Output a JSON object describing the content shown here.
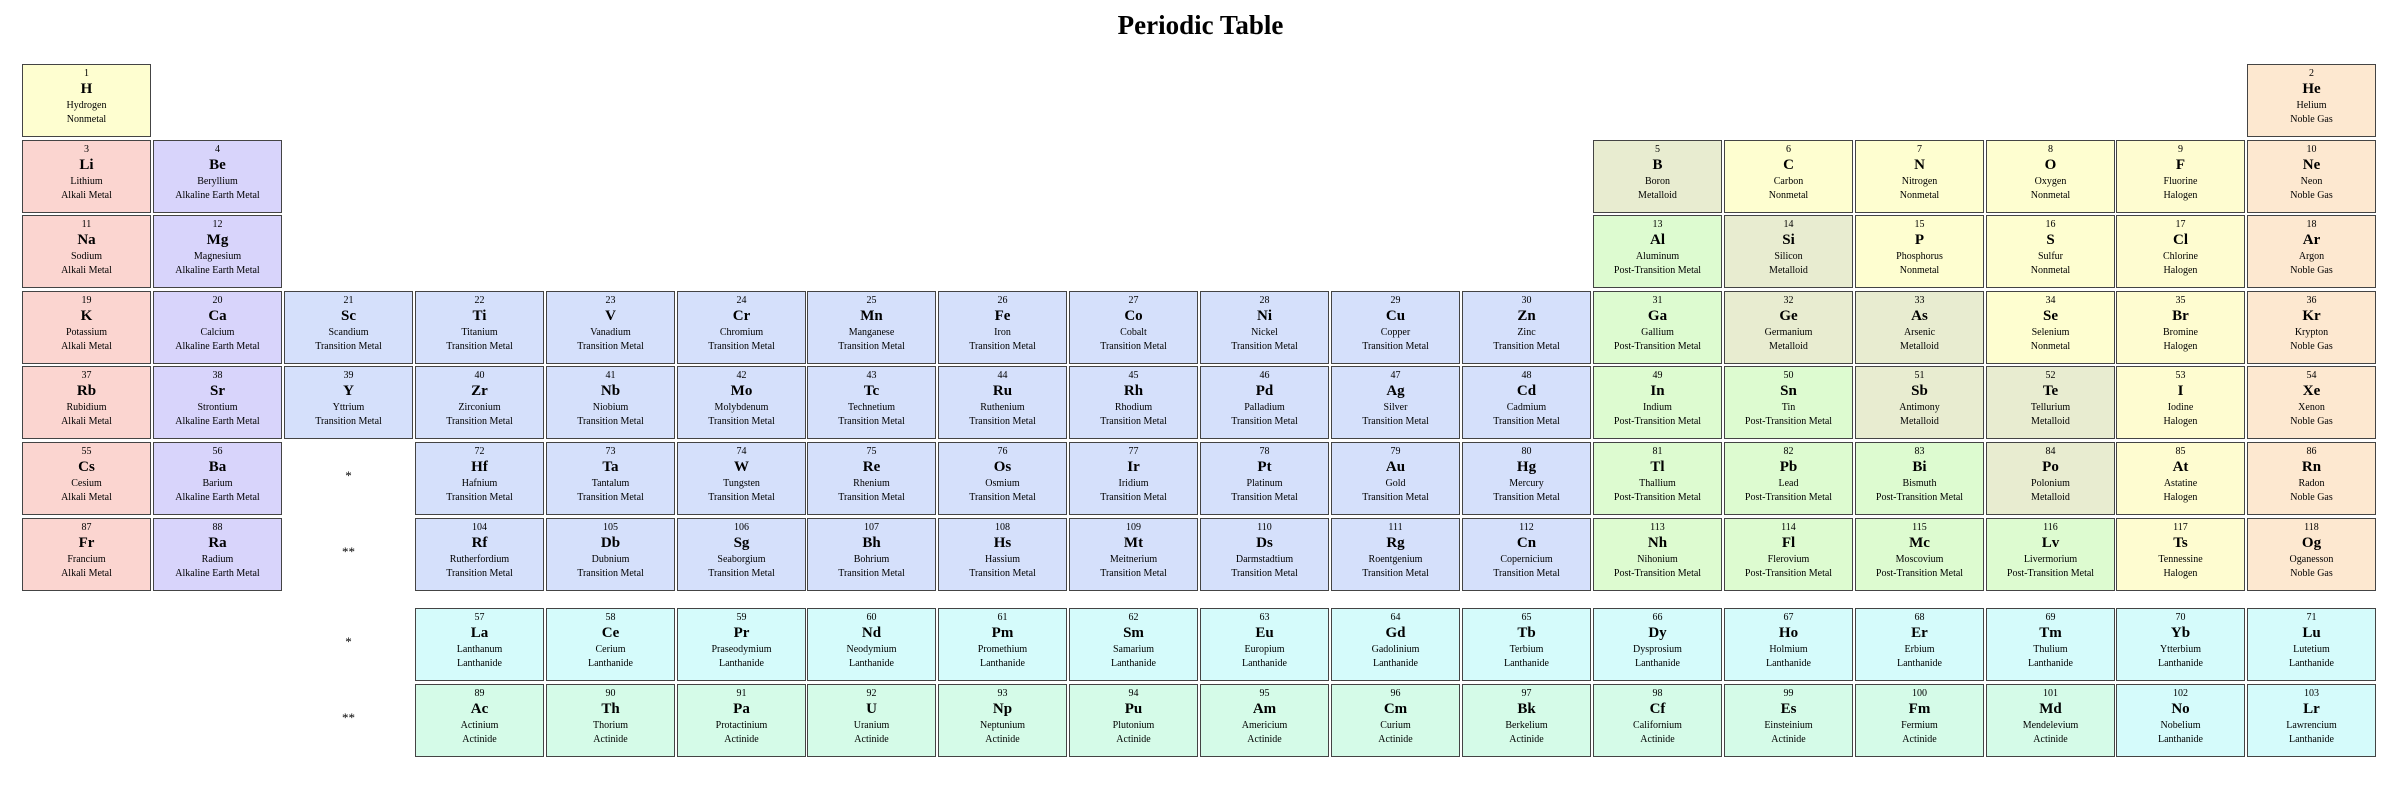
{
  "title": "Periodic Table",
  "category_colors": {
    "Nonmetal": "#fefed0",
    "Noble Gas": "#fde8d0",
    "Alkali Metal": "#fbd5d0",
    "Alkaline Earth Metal": "#d8d4fb",
    "Transition Metal": "#d5e0fb",
    "Metalloid": "#e8ecd0",
    "Post-Transition Metal": "#ddfbd0",
    "Halogen": "#fefcd0",
    "Lanthanide": "#d5fbfb",
    "Actinide": "#d5fbe8"
  },
  "markers": [
    {
      "text": "*",
      "row": 5,
      "col": 2
    },
    {
      "text": "**",
      "row": 6,
      "col": 2
    },
    {
      "text": "*",
      "row": 8,
      "col": 2
    },
    {
      "text": "**",
      "row": 9,
      "col": 2
    }
  ],
  "elements": [
    {
      "n": "1",
      "s": "H",
      "name": "Hydrogen",
      "cat": "Nonmetal",
      "row": 0,
      "col": 0
    },
    {
      "n": "2",
      "s": "He",
      "name": "Helium",
      "cat": "Noble Gas",
      "row": 0,
      "col": 17
    },
    {
      "n": "3",
      "s": "Li",
      "name": "Lithium",
      "cat": "Alkali Metal",
      "row": 1,
      "col": 0
    },
    {
      "n": "4",
      "s": "Be",
      "name": "Beryllium",
      "cat": "Alkaline Earth Metal",
      "row": 1,
      "col": 1
    },
    {
      "n": "5",
      "s": "B",
      "name": "Boron",
      "cat": "Metalloid",
      "row": 1,
      "col": 12
    },
    {
      "n": "6",
      "s": "C",
      "name": "Carbon",
      "cat": "Nonmetal",
      "row": 1,
      "col": 13
    },
    {
      "n": "7",
      "s": "N",
      "name": "Nitrogen",
      "cat": "Nonmetal",
      "row": 1,
      "col": 14
    },
    {
      "n": "8",
      "s": "O",
      "name": "Oxygen",
      "cat": "Nonmetal",
      "row": 1,
      "col": 15
    },
    {
      "n": "9",
      "s": "F",
      "name": "Fluorine",
      "cat": "Halogen",
      "row": 1,
      "col": 16
    },
    {
      "n": "10",
      "s": "Ne",
      "name": "Neon",
      "cat": "Noble Gas",
      "row": 1,
      "col": 17
    },
    {
      "n": "11",
      "s": "Na",
      "name": "Sodium",
      "cat": "Alkali Metal",
      "row": 2,
      "col": 0
    },
    {
      "n": "12",
      "s": "Mg",
      "name": "Magnesium",
      "cat": "Alkaline Earth Metal",
      "row": 2,
      "col": 1
    },
    {
      "n": "13",
      "s": "Al",
      "name": "Aluminum",
      "cat": "Post-Transition Metal",
      "row": 2,
      "col": 12
    },
    {
      "n": "14",
      "s": "Si",
      "name": "Silicon",
      "cat": "Metalloid",
      "row": 2,
      "col": 13
    },
    {
      "n": "15",
      "s": "P",
      "name": "Phosphorus",
      "cat": "Nonmetal",
      "row": 2,
      "col": 14
    },
    {
      "n": "16",
      "s": "S",
      "name": "Sulfur",
      "cat": "Nonmetal",
      "row": 2,
      "col": 15
    },
    {
      "n": "17",
      "s": "Cl",
      "name": "Chlorine",
      "cat": "Halogen",
      "row": 2,
      "col": 16
    },
    {
      "n": "18",
      "s": "Ar",
      "name": "Argon",
      "cat": "Noble Gas",
      "row": 2,
      "col": 17
    },
    {
      "n": "19",
      "s": "K",
      "name": "Potassium",
      "cat": "Alkali Metal",
      "row": 3,
      "col": 0
    },
    {
      "n": "20",
      "s": "Ca",
      "name": "Calcium",
      "cat": "Alkaline Earth Metal",
      "row": 3,
      "col": 1
    },
    {
      "n": "21",
      "s": "Sc",
      "name": "Scandium",
      "cat": "Transition Metal",
      "row": 3,
      "col": 2
    },
    {
      "n": "22",
      "s": "Ti",
      "name": "Titanium",
      "cat": "Transition Metal",
      "row": 3,
      "col": 3
    },
    {
      "n": "23",
      "s": "V",
      "name": "Vanadium",
      "cat": "Transition Metal",
      "row": 3,
      "col": 4
    },
    {
      "n": "24",
      "s": "Cr",
      "name": "Chromium",
      "cat": "Transition Metal",
      "row": 3,
      "col": 5
    },
    {
      "n": "25",
      "s": "Mn",
      "name": "Manganese",
      "cat": "Transition Metal",
      "row": 3,
      "col": 6
    },
    {
      "n": "26",
      "s": "Fe",
      "name": "Iron",
      "cat": "Transition Metal",
      "row": 3,
      "col": 7
    },
    {
      "n": "27",
      "s": "Co",
      "name": "Cobalt",
      "cat": "Transition Metal",
      "row": 3,
      "col": 8
    },
    {
      "n": "28",
      "s": "Ni",
      "name": "Nickel",
      "cat": "Transition Metal",
      "row": 3,
      "col": 9
    },
    {
      "n": "29",
      "s": "Cu",
      "name": "Copper",
      "cat": "Transition Metal",
      "row": 3,
      "col": 10
    },
    {
      "n": "30",
      "s": "Zn",
      "name": "Zinc",
      "cat": "Transition Metal",
      "row": 3,
      "col": 11
    },
    {
      "n": "31",
      "s": "Ga",
      "name": "Gallium",
      "cat": "Post-Transition Metal",
      "row": 3,
      "col": 12
    },
    {
      "n": "32",
      "s": "Ge",
      "name": "Germanium",
      "cat": "Metalloid",
      "row": 3,
      "col": 13
    },
    {
      "n": "33",
      "s": "As",
      "name": "Arsenic",
      "cat": "Metalloid",
      "row": 3,
      "col": 14
    },
    {
      "n": "34",
      "s": "Se",
      "name": "Selenium",
      "cat": "Nonmetal",
      "row": 3,
      "col": 15
    },
    {
      "n": "35",
      "s": "Br",
      "name": "Bromine",
      "cat": "Halogen",
      "row": 3,
      "col": 16
    },
    {
      "n": "36",
      "s": "Kr",
      "name": "Krypton",
      "cat": "Noble Gas",
      "row": 3,
      "col": 17
    },
    {
      "n": "37",
      "s": "Rb",
      "name": "Rubidium",
      "cat": "Alkali Metal",
      "row": 4,
      "col": 0
    },
    {
      "n": "38",
      "s": "Sr",
      "name": "Strontium",
      "cat": "Alkaline Earth Metal",
      "row": 4,
      "col": 1
    },
    {
      "n": "39",
      "s": "Y",
      "name": "Yttrium",
      "cat": "Transition Metal",
      "row": 4,
      "col": 2
    },
    {
      "n": "40",
      "s": "Zr",
      "name": "Zirconium",
      "cat": "Transition Metal",
      "row": 4,
      "col": 3
    },
    {
      "n": "41",
      "s": "Nb",
      "name": "Niobium",
      "cat": "Transition Metal",
      "row": 4,
      "col": 4
    },
    {
      "n": "42",
      "s": "Mo",
      "name": "Molybdenum",
      "cat": "Transition Metal",
      "row": 4,
      "col": 5
    },
    {
      "n": "43",
      "s": "Tc",
      "name": "Technetium",
      "cat": "Transition Metal",
      "row": 4,
      "col": 6
    },
    {
      "n": "44",
      "s": "Ru",
      "name": "Ruthenium",
      "cat": "Transition Metal",
      "row": 4,
      "col": 7
    },
    {
      "n": "45",
      "s": "Rh",
      "name": "Rhodium",
      "cat": "Transition Metal",
      "row": 4,
      "col": 8
    },
    {
      "n": "46",
      "s": "Pd",
      "name": "Palladium",
      "cat": "Transition Metal",
      "row": 4,
      "col": 9
    },
    {
      "n": "47",
      "s": "Ag",
      "name": "Silver",
      "cat": "Transition Metal",
      "row": 4,
      "col": 10
    },
    {
      "n": "48",
      "s": "Cd",
      "name": "Cadmium",
      "cat": "Transition Metal",
      "row": 4,
      "col": 11
    },
    {
      "n": "49",
      "s": "In",
      "name": "Indium",
      "cat": "Post-Transition Metal",
      "row": 4,
      "col": 12
    },
    {
      "n": "50",
      "s": "Sn",
      "name": "Tin",
      "cat": "Post-Transition Metal",
      "row": 4,
      "col": 13
    },
    {
      "n": "51",
      "s": "Sb",
      "name": "Antimony",
      "cat": "Metalloid",
      "row": 4,
      "col": 14
    },
    {
      "n": "52",
      "s": "Te",
      "name": "Tellurium",
      "cat": "Metalloid",
      "row": 4,
      "col": 15
    },
    {
      "n": "53",
      "s": "I",
      "name": "Iodine",
      "cat": "Halogen",
      "row": 4,
      "col": 16
    },
    {
      "n": "54",
      "s": "Xe",
      "name": "Xenon",
      "cat": "Noble Gas",
      "row": 4,
      "col": 17
    },
    {
      "n": "55",
      "s": "Cs",
      "name": "Cesium",
      "cat": "Alkali Metal",
      "row": 5,
      "col": 0
    },
    {
      "n": "56",
      "s": "Ba",
      "name": "Barium",
      "cat": "Alkaline Earth Metal",
      "row": 5,
      "col": 1
    },
    {
      "n": "72",
      "s": "Hf",
      "name": "Hafnium",
      "cat": "Transition Metal",
      "row": 5,
      "col": 3
    },
    {
      "n": "73",
      "s": "Ta",
      "name": "Tantalum",
      "cat": "Transition Metal",
      "row": 5,
      "col": 4
    },
    {
      "n": "74",
      "s": "W",
      "name": "Tungsten",
      "cat": "Transition Metal",
      "row": 5,
      "col": 5
    },
    {
      "n": "75",
      "s": "Re",
      "name": "Rhenium",
      "cat": "Transition Metal",
      "row": 5,
      "col": 6
    },
    {
      "n": "76",
      "s": "Os",
      "name": "Osmium",
      "cat": "Transition Metal",
      "row": 5,
      "col": 7
    },
    {
      "n": "77",
      "s": "Ir",
      "name": "Iridium",
      "cat": "Transition Metal",
      "row": 5,
      "col": 8
    },
    {
      "n": "78",
      "s": "Pt",
      "name": "Platinum",
      "cat": "Transition Metal",
      "row": 5,
      "col": 9
    },
    {
      "n": "79",
      "s": "Au",
      "name": "Gold",
      "cat": "Transition Metal",
      "row": 5,
      "col": 10
    },
    {
      "n": "80",
      "s": "Hg",
      "name": "Mercury",
      "cat": "Transition Metal",
      "row": 5,
      "col": 11
    },
    {
      "n": "81",
      "s": "Tl",
      "name": "Thallium",
      "cat": "Post-Transition Metal",
      "row": 5,
      "col": 12
    },
    {
      "n": "82",
      "s": "Pb",
      "name": "Lead",
      "cat": "Post-Transition Metal",
      "row": 5,
      "col": 13
    },
    {
      "n": "83",
      "s": "Bi",
      "name": "Bismuth",
      "cat": "Post-Transition Metal",
      "row": 5,
      "col": 14
    },
    {
      "n": "84",
      "s": "Po",
      "name": "Polonium",
      "cat": "Metalloid",
      "row": 5,
      "col": 15
    },
    {
      "n": "85",
      "s": "At",
      "name": "Astatine",
      "cat": "Halogen",
      "row": 5,
      "col": 16
    },
    {
      "n": "86",
      "s": "Rn",
      "name": "Radon",
      "cat": "Noble Gas",
      "row": 5,
      "col": 17
    },
    {
      "n": "87",
      "s": "Fr",
      "name": "Francium",
      "cat": "Alkali Metal",
      "row": 6,
      "col": 0
    },
    {
      "n": "88",
      "s": "Ra",
      "name": "Radium",
      "cat": "Alkaline Earth Metal",
      "row": 6,
      "col": 1
    },
    {
      "n": "104",
      "s": "Rf",
      "name": "Rutherfordium",
      "cat": "Transition Metal",
      "row": 6,
      "col": 3
    },
    {
      "n": "105",
      "s": "Db",
      "name": "Dubnium",
      "cat": "Transition Metal",
      "row": 6,
      "col": 4
    },
    {
      "n": "106",
      "s": "Sg",
      "name": "Seaborgium",
      "cat": "Transition Metal",
      "row": 6,
      "col": 5
    },
    {
      "n": "107",
      "s": "Bh",
      "name": "Bohrium",
      "cat": "Transition Metal",
      "row": 6,
      "col": 6
    },
    {
      "n": "108",
      "s": "Hs",
      "name": "Hassium",
      "cat": "Transition Metal",
      "row": 6,
      "col": 7
    },
    {
      "n": "109",
      "s": "Mt",
      "name": "Meitnerium",
      "cat": "Transition Metal",
      "row": 6,
      "col": 8
    },
    {
      "n": "110",
      "s": "Ds",
      "name": "Darmstadtium",
      "cat": "Transition Metal",
      "row": 6,
      "col": 9
    },
    {
      "n": "111",
      "s": "Rg",
      "name": "Roentgenium",
      "cat": "Transition Metal",
      "row": 6,
      "col": 10
    },
    {
      "n": "112",
      "s": "Cn",
      "name": "Copernicium",
      "cat": "Transition Metal",
      "row": 6,
      "col": 11
    },
    {
      "n": "113",
      "s": "Nh",
      "name": "Nihonium",
      "cat": "Post-Transition Metal",
      "row": 6,
      "col": 12
    },
    {
      "n": "114",
      "s": "Fl",
      "name": "Flerovium",
      "cat": "Post-Transition Metal",
      "row": 6,
      "col": 13
    },
    {
      "n": "115",
      "s": "Mc",
      "name": "Moscovium",
      "cat": "Post-Transition Metal",
      "row": 6,
      "col": 14
    },
    {
      "n": "116",
      "s": "Lv",
      "name": "Livermorium",
      "cat": "Post-Transition Metal",
      "row": 6,
      "col": 15
    },
    {
      "n": "117",
      "s": "Ts",
      "name": "Tennessine",
      "cat": "Halogen",
      "row": 6,
      "col": 16
    },
    {
      "n": "118",
      "s": "Og",
      "name": "Oganesson",
      "cat": "Noble Gas",
      "row": 6,
      "col": 17
    },
    {
      "n": "57",
      "s": "La",
      "name": "Lanthanum",
      "cat": "Lanthanide",
      "row": 8,
      "col": 3
    },
    {
      "n": "58",
      "s": "Ce",
      "name": "Cerium",
      "cat": "Lanthanide",
      "row": 8,
      "col": 4
    },
    {
      "n": "59",
      "s": "Pr",
      "name": "Praseodymium",
      "cat": "Lanthanide",
      "row": 8,
      "col": 5
    },
    {
      "n": "60",
      "s": "Nd",
      "name": "Neodymium",
      "cat": "Lanthanide",
      "row": 8,
      "col": 6
    },
    {
      "n": "61",
      "s": "Pm",
      "name": "Promethium",
      "cat": "Lanthanide",
      "row": 8,
      "col": 7
    },
    {
      "n": "62",
      "s": "Sm",
      "name": "Samarium",
      "cat": "Lanthanide",
      "row": 8,
      "col": 8
    },
    {
      "n": "63",
      "s": "Eu",
      "name": "Europium",
      "cat": "Lanthanide",
      "row": 8,
      "col": 9
    },
    {
      "n": "64",
      "s": "Gd",
      "name": "Gadolinium",
      "cat": "Lanthanide",
      "row": 8,
      "col": 10
    },
    {
      "n": "65",
      "s": "Tb",
      "name": "Terbium",
      "cat": "Lanthanide",
      "row": 8,
      "col": 11
    },
    {
      "n": "66",
      "s": "Dy",
      "name": "Dysprosium",
      "cat": "Lanthanide",
      "row": 8,
      "col": 12
    },
    {
      "n": "67",
      "s": "Ho",
      "name": "Holmium",
      "cat": "Lanthanide",
      "row": 8,
      "col": 13
    },
    {
      "n": "68",
      "s": "Er",
      "name": "Erbium",
      "cat": "Lanthanide",
      "row": 8,
      "col": 14
    },
    {
      "n": "69",
      "s": "Tm",
      "name": "Thulium",
      "cat": "Lanthanide",
      "row": 8,
      "col": 15
    },
    {
      "n": "70",
      "s": "Yb",
      "name": "Ytterbium",
      "cat": "Lanthanide",
      "row": 8,
      "col": 16
    },
    {
      "n": "71",
      "s": "Lu",
      "name": "Lutetium",
      "cat": "Lanthanide",
      "row": 8,
      "col": 17
    },
    {
      "n": "89",
      "s": "Ac",
      "name": "Actinium",
      "cat": "Actinide",
      "row": 9,
      "col": 3
    },
    {
      "n": "90",
      "s": "Th",
      "name": "Thorium",
      "cat": "Actinide",
      "row": 9,
      "col": 4
    },
    {
      "n": "91",
      "s": "Pa",
      "name": "Protactinium",
      "cat": "Actinide",
      "row": 9,
      "col": 5
    },
    {
      "n": "92",
      "s": "U",
      "name": "Uranium",
      "cat": "Actinide",
      "row": 9,
      "col": 6
    },
    {
      "n": "93",
      "s": "Np",
      "name": "Neptunium",
      "cat": "Actinide",
      "row": 9,
      "col": 7
    },
    {
      "n": "94",
      "s": "Pu",
      "name": "Plutonium",
      "cat": "Actinide",
      "row": 9,
      "col": 8
    },
    {
      "n": "95",
      "s": "Am",
      "name": "Americium",
      "cat": "Actinide",
      "row": 9,
      "col": 9
    },
    {
      "n": "96",
      "s": "Cm",
      "name": "Curium",
      "cat": "Actinide",
      "row": 9,
      "col": 10
    },
    {
      "n": "97",
      "s": "Bk",
      "name": "Berkelium",
      "cat": "Actinide",
      "row": 9,
      "col": 11
    },
    {
      "n": "98",
      "s": "Cf",
      "name": "Californium",
      "cat": "Actinide",
      "row": 9,
      "col": 12
    },
    {
      "n": "99",
      "s": "Es",
      "name": "Einsteinium",
      "cat": "Actinide",
      "row": 9,
      "col": 13
    },
    {
      "n": "100",
      "s": "Fm",
      "name": "Fermium",
      "cat": "Actinide",
      "row": 9,
      "col": 14
    },
    {
      "n": "101",
      "s": "Md",
      "name": "Mendelevium",
      "cat": "Actinide",
      "row": 9,
      "col": 15
    },
    {
      "n": "102",
      "s": "No",
      "name": "Nobelium",
      "cat": "Lanthanide",
      "row": 9,
      "col": 16
    },
    {
      "n": "103",
      "s": "Lr",
      "name": "Lawrencium",
      "cat": "Lanthanide",
      "row": 9,
      "col": 17
    }
  ]
}
